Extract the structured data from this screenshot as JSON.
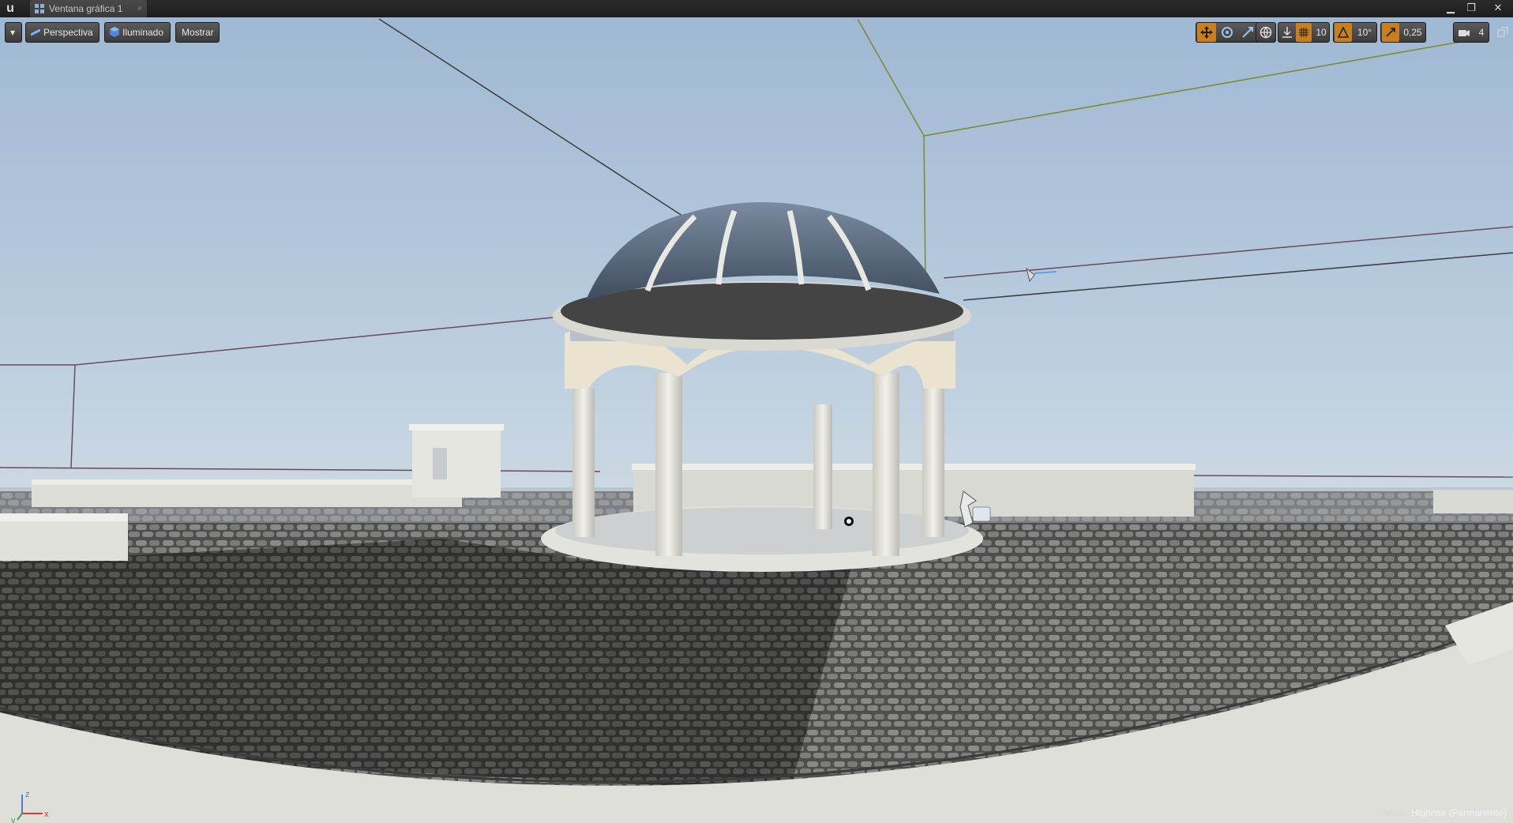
{
  "app": {
    "logo_text": "u",
    "tab": {
      "title": "Ventana gráfica 1",
      "close_glyph": "×",
      "icon": "viewport-grid-icon"
    },
    "window_controls": {
      "minimize": "▁",
      "restore": "❐",
      "close": "✕"
    }
  },
  "viewport": {
    "menu_glyph": "▾",
    "view_mode": {
      "label": "Perspectiva",
      "icon": "perspective-icon"
    },
    "lighting": {
      "label": "Iluminado",
      "icon": "lit-cube-icon"
    },
    "show": {
      "label": "Mostrar"
    },
    "transform_tools": [
      {
        "name": "translate",
        "icon": "translate-icon",
        "active": true
      },
      {
        "name": "rotate",
        "icon": "rotate-icon",
        "active": false
      },
      {
        "name": "scale",
        "icon": "scale-icon",
        "active": false
      }
    ],
    "coordinate_space_icon": "globe-icon",
    "surface_snap_icon": "surface-snap-icon",
    "grid_snap": {
      "icon": "grid-icon",
      "value": "10"
    },
    "rotation_snap": {
      "icon": "angle-icon",
      "value": "10°"
    },
    "scale_snap": {
      "icon": "scale-snap-icon",
      "value": "0,25"
    },
    "camera_speed": {
      "icon": "camera-speed-icon",
      "value": "4"
    },
    "maximize_icon": "maximize-icon",
    "level": {
      "prefix": "Nivel:",
      "name": "Highrise (Permanente)"
    },
    "axis_labels": {
      "x": "x",
      "y": "y",
      "z": "z"
    }
  },
  "colors": {
    "accent_active": "#c97f1c",
    "sky_top": "#9fb8d3",
    "sky_horizon": "#d3dde5",
    "ground": "#6b6b6b",
    "stone": "#dcdcd4",
    "dome_glass": "#55657a"
  }
}
